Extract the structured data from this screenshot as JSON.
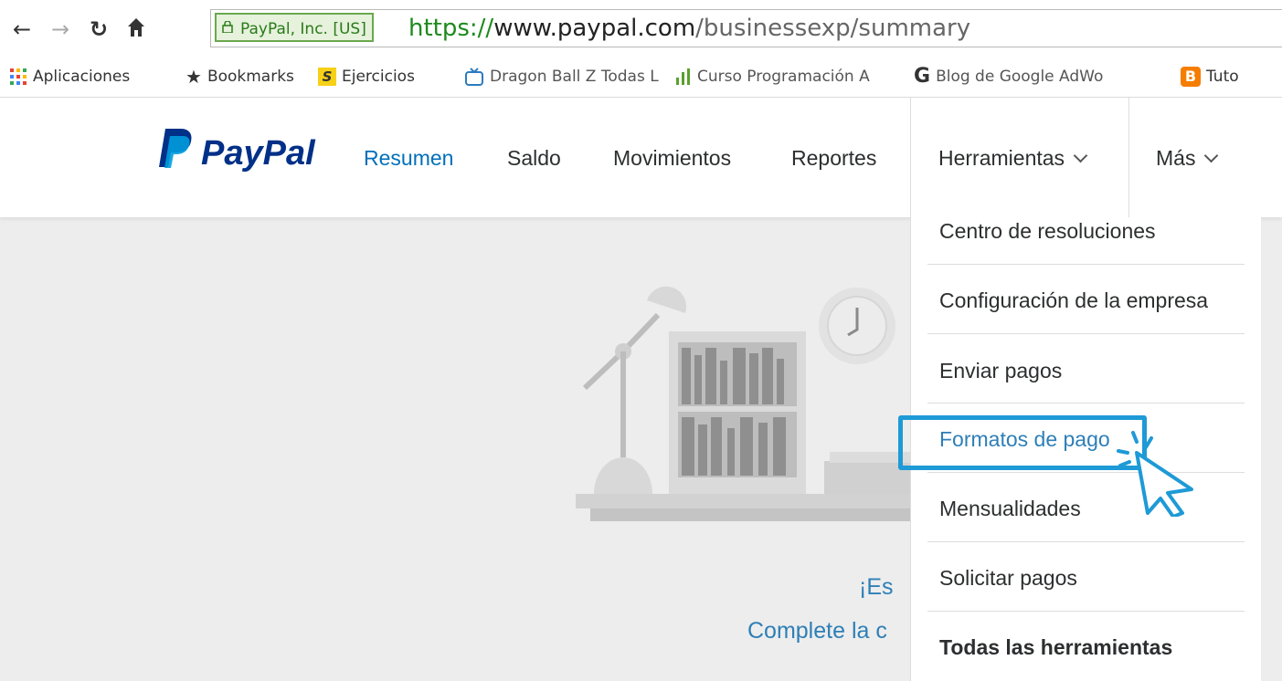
{
  "browser": {
    "secure_label": "PayPal, Inc. [US]",
    "url_scheme": "https://",
    "url_host": "www.paypal.com",
    "url_path": "/businessexp/summary",
    "bookmarks": [
      {
        "label": "Aplicaciones",
        "icon": "apps-grid-icon"
      },
      {
        "label": "Bookmarks",
        "icon": "star-icon"
      },
      {
        "label": "Ejercicios",
        "icon": "s-logo-icon"
      },
      {
        "label": "Dragon Ball Z Todas L",
        "icon": "tv-icon"
      },
      {
        "label": "Curso Programación A",
        "icon": "bar-chart-icon"
      },
      {
        "label": "Blog de Google AdWo",
        "icon": "google-g-icon"
      },
      {
        "label": "Tuto",
        "icon": "blogger-icon"
      }
    ]
  },
  "header": {
    "logo_text": "PayPal",
    "nav": [
      {
        "label": "Resumen",
        "active": true
      },
      {
        "label": "Saldo",
        "active": false
      },
      {
        "label": "Movimientos",
        "active": false
      },
      {
        "label": "Reportes",
        "active": false
      }
    ],
    "tools_label": "Herramientas",
    "more_label": "Más"
  },
  "dropdown": {
    "items": [
      {
        "label": "Centro de resoluciones"
      },
      {
        "label": "Configuración de la empresa"
      },
      {
        "label": "Enviar pagos"
      },
      {
        "label": "Formatos de pago",
        "highlighted": true
      },
      {
        "label": "Mensualidades"
      },
      {
        "label": "Solicitar pagos"
      },
      {
        "label": "Todas las herramientas",
        "bold": true
      }
    ]
  },
  "main": {
    "line1": "¡Es",
    "line2": "Complete la c"
  },
  "colors": {
    "paypal_blue": "#003087",
    "paypal_light_blue": "#009cde",
    "link_blue": "#0070ba",
    "highlight_box": "#1e9ad6"
  }
}
